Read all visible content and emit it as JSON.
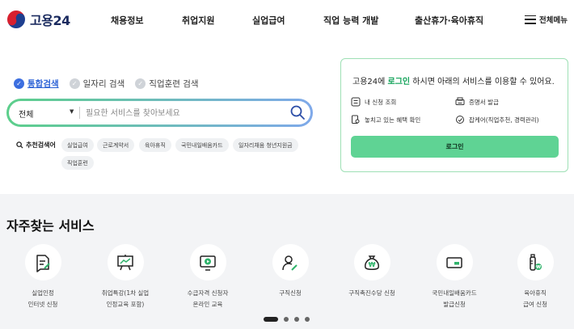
{
  "header": {
    "logo_text": "고용24",
    "nav": [
      "채용정보",
      "취업지원",
      "실업급여",
      "직업 능력 개발",
      "출산휴가·육아휴직"
    ],
    "menu_label": "전체메뉴"
  },
  "search": {
    "tabs": [
      "통합검색",
      "일자리 검색",
      "직업훈련 검색"
    ],
    "active_tab": "통합검색",
    "scope": "전체",
    "placeholder": "필요한 서비스를 찾아보세요",
    "recommend_label": "추천검색어",
    "chips": [
      "실업급여",
      "근로계약서",
      "육아휴직",
      "국민내일배움카드",
      "일자리채움 청년지원금",
      "직업훈련"
    ]
  },
  "login_panel": {
    "title_prefix": "고용24에 ",
    "title_link": "로그인",
    "title_suffix": " 하시면 아래의 서비스를 이용할 수 있어요.",
    "items": [
      "내 신청 조회",
      "증명서 발급",
      "놓치고 있는 혜택 확인",
      "잡케어(직업추천, 경력관리)"
    ],
    "button": "로그인"
  },
  "faq": {
    "title": "자주찾는 서비스",
    "services": [
      {
        "label": "실업인정\n인터넷 신청",
        "icon": "document-edit-icon"
      },
      {
        "label": "취업특강(1차 실업\n인정교육 포함)",
        "icon": "presentation-board-icon"
      },
      {
        "label": "수급자격 신청자\n온라인 교육",
        "icon": "monitor-play-icon"
      },
      {
        "label": "구직신청",
        "icon": "person-edit-icon"
      },
      {
        "label": "구직촉진수당 신청",
        "icon": "money-bag-icon"
      },
      {
        "label": "국민내일배움카드\n발급신청",
        "icon": "credit-card-icon"
      },
      {
        "label": "육아휴직\n급여 신청",
        "icon": "baby-bottle-icon"
      }
    ]
  },
  "colors": {
    "accent_green": "#5fd394",
    "accent_blue": "#2d63d6",
    "panel_border": "#9ee0b5"
  }
}
